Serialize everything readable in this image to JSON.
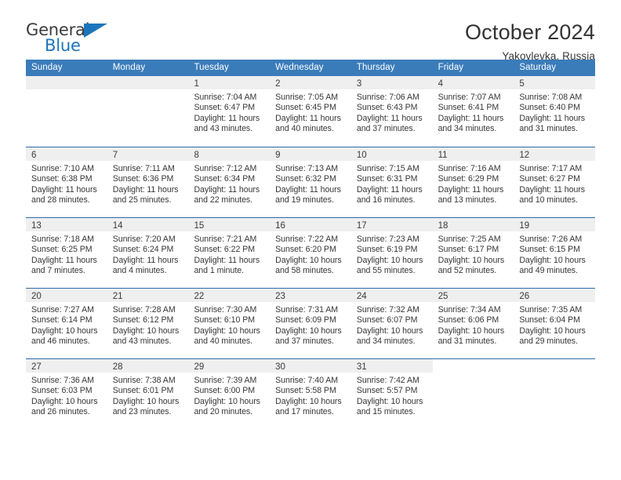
{
  "brand": {
    "name_part1": "General",
    "name_part2": "Blue",
    "logo_icon": "triangle-icon",
    "accent_color": "#1b75bb"
  },
  "header": {
    "title": "October 2024",
    "subtitle": "Yakovlevka, Russia"
  },
  "colors": {
    "header_row_bg": "#3a7cba",
    "row_divider": "#2e6ca8",
    "day_head_bg": "#efefef",
    "text": "#363636"
  },
  "weekdays": [
    "Sunday",
    "Monday",
    "Tuesday",
    "Wednesday",
    "Thursday",
    "Friday",
    "Saturday"
  ],
  "weeks": [
    [
      {
        "day": "",
        "lines": [],
        "placeholder": true
      },
      {
        "day": "",
        "lines": [],
        "placeholder": true
      },
      {
        "day": "1",
        "lines": [
          "Sunrise: 7:04 AM",
          "Sunset: 6:47 PM",
          "Daylight: 11 hours",
          "and 43 minutes."
        ]
      },
      {
        "day": "2",
        "lines": [
          "Sunrise: 7:05 AM",
          "Sunset: 6:45 PM",
          "Daylight: 11 hours",
          "and 40 minutes."
        ]
      },
      {
        "day": "3",
        "lines": [
          "Sunrise: 7:06 AM",
          "Sunset: 6:43 PM",
          "Daylight: 11 hours",
          "and 37 minutes."
        ]
      },
      {
        "day": "4",
        "lines": [
          "Sunrise: 7:07 AM",
          "Sunset: 6:41 PM",
          "Daylight: 11 hours",
          "and 34 minutes."
        ]
      },
      {
        "day": "5",
        "lines": [
          "Sunrise: 7:08 AM",
          "Sunset: 6:40 PM",
          "Daylight: 11 hours",
          "and 31 minutes."
        ]
      }
    ],
    [
      {
        "day": "6",
        "lines": [
          "Sunrise: 7:10 AM",
          "Sunset: 6:38 PM",
          "Daylight: 11 hours",
          "and 28 minutes."
        ]
      },
      {
        "day": "7",
        "lines": [
          "Sunrise: 7:11 AM",
          "Sunset: 6:36 PM",
          "Daylight: 11 hours",
          "and 25 minutes."
        ]
      },
      {
        "day": "8",
        "lines": [
          "Sunrise: 7:12 AM",
          "Sunset: 6:34 PM",
          "Daylight: 11 hours",
          "and 22 minutes."
        ]
      },
      {
        "day": "9",
        "lines": [
          "Sunrise: 7:13 AM",
          "Sunset: 6:32 PM",
          "Daylight: 11 hours",
          "and 19 minutes."
        ]
      },
      {
        "day": "10",
        "lines": [
          "Sunrise: 7:15 AM",
          "Sunset: 6:31 PM",
          "Daylight: 11 hours",
          "and 16 minutes."
        ]
      },
      {
        "day": "11",
        "lines": [
          "Sunrise: 7:16 AM",
          "Sunset: 6:29 PM",
          "Daylight: 11 hours",
          "and 13 minutes."
        ]
      },
      {
        "day": "12",
        "lines": [
          "Sunrise: 7:17 AM",
          "Sunset: 6:27 PM",
          "Daylight: 11 hours",
          "and 10 minutes."
        ]
      }
    ],
    [
      {
        "day": "13",
        "lines": [
          "Sunrise: 7:18 AM",
          "Sunset: 6:25 PM",
          "Daylight: 11 hours",
          "and 7 minutes."
        ]
      },
      {
        "day": "14",
        "lines": [
          "Sunrise: 7:20 AM",
          "Sunset: 6:24 PM",
          "Daylight: 11 hours",
          "and 4 minutes."
        ]
      },
      {
        "day": "15",
        "lines": [
          "Sunrise: 7:21 AM",
          "Sunset: 6:22 PM",
          "Daylight: 11 hours",
          "and 1 minute."
        ]
      },
      {
        "day": "16",
        "lines": [
          "Sunrise: 7:22 AM",
          "Sunset: 6:20 PM",
          "Daylight: 10 hours",
          "and 58 minutes."
        ]
      },
      {
        "day": "17",
        "lines": [
          "Sunrise: 7:23 AM",
          "Sunset: 6:19 PM",
          "Daylight: 10 hours",
          "and 55 minutes."
        ]
      },
      {
        "day": "18",
        "lines": [
          "Sunrise: 7:25 AM",
          "Sunset: 6:17 PM",
          "Daylight: 10 hours",
          "and 52 minutes."
        ]
      },
      {
        "day": "19",
        "lines": [
          "Sunrise: 7:26 AM",
          "Sunset: 6:15 PM",
          "Daylight: 10 hours",
          "and 49 minutes."
        ]
      }
    ],
    [
      {
        "day": "20",
        "lines": [
          "Sunrise: 7:27 AM",
          "Sunset: 6:14 PM",
          "Daylight: 10 hours",
          "and 46 minutes."
        ]
      },
      {
        "day": "21",
        "lines": [
          "Sunrise: 7:28 AM",
          "Sunset: 6:12 PM",
          "Daylight: 10 hours",
          "and 43 minutes."
        ]
      },
      {
        "day": "22",
        "lines": [
          "Sunrise: 7:30 AM",
          "Sunset: 6:10 PM",
          "Daylight: 10 hours",
          "and 40 minutes."
        ]
      },
      {
        "day": "23",
        "lines": [
          "Sunrise: 7:31 AM",
          "Sunset: 6:09 PM",
          "Daylight: 10 hours",
          "and 37 minutes."
        ]
      },
      {
        "day": "24",
        "lines": [
          "Sunrise: 7:32 AM",
          "Sunset: 6:07 PM",
          "Daylight: 10 hours",
          "and 34 minutes."
        ]
      },
      {
        "day": "25",
        "lines": [
          "Sunrise: 7:34 AM",
          "Sunset: 6:06 PM",
          "Daylight: 10 hours",
          "and 31 minutes."
        ]
      },
      {
        "day": "26",
        "lines": [
          "Sunrise: 7:35 AM",
          "Sunset: 6:04 PM",
          "Daylight: 10 hours",
          "and 29 minutes."
        ]
      }
    ],
    [
      {
        "day": "27",
        "lines": [
          "Sunrise: 7:36 AM",
          "Sunset: 6:03 PM",
          "Daylight: 10 hours",
          "and 26 minutes."
        ]
      },
      {
        "day": "28",
        "lines": [
          "Sunrise: 7:38 AM",
          "Sunset: 6:01 PM",
          "Daylight: 10 hours",
          "and 23 minutes."
        ]
      },
      {
        "day": "29",
        "lines": [
          "Sunrise: 7:39 AM",
          "Sunset: 6:00 PM",
          "Daylight: 10 hours",
          "and 20 minutes."
        ]
      },
      {
        "day": "30",
        "lines": [
          "Sunrise: 7:40 AM",
          "Sunset: 5:58 PM",
          "Daylight: 10 hours",
          "and 17 minutes."
        ]
      },
      {
        "day": "31",
        "lines": [
          "Sunrise: 7:42 AM",
          "Sunset: 5:57 PM",
          "Daylight: 10 hours",
          "and 15 minutes."
        ]
      },
      {
        "day": "",
        "lines": [],
        "blank": true
      },
      {
        "day": "",
        "lines": [],
        "blank": true
      }
    ]
  ]
}
